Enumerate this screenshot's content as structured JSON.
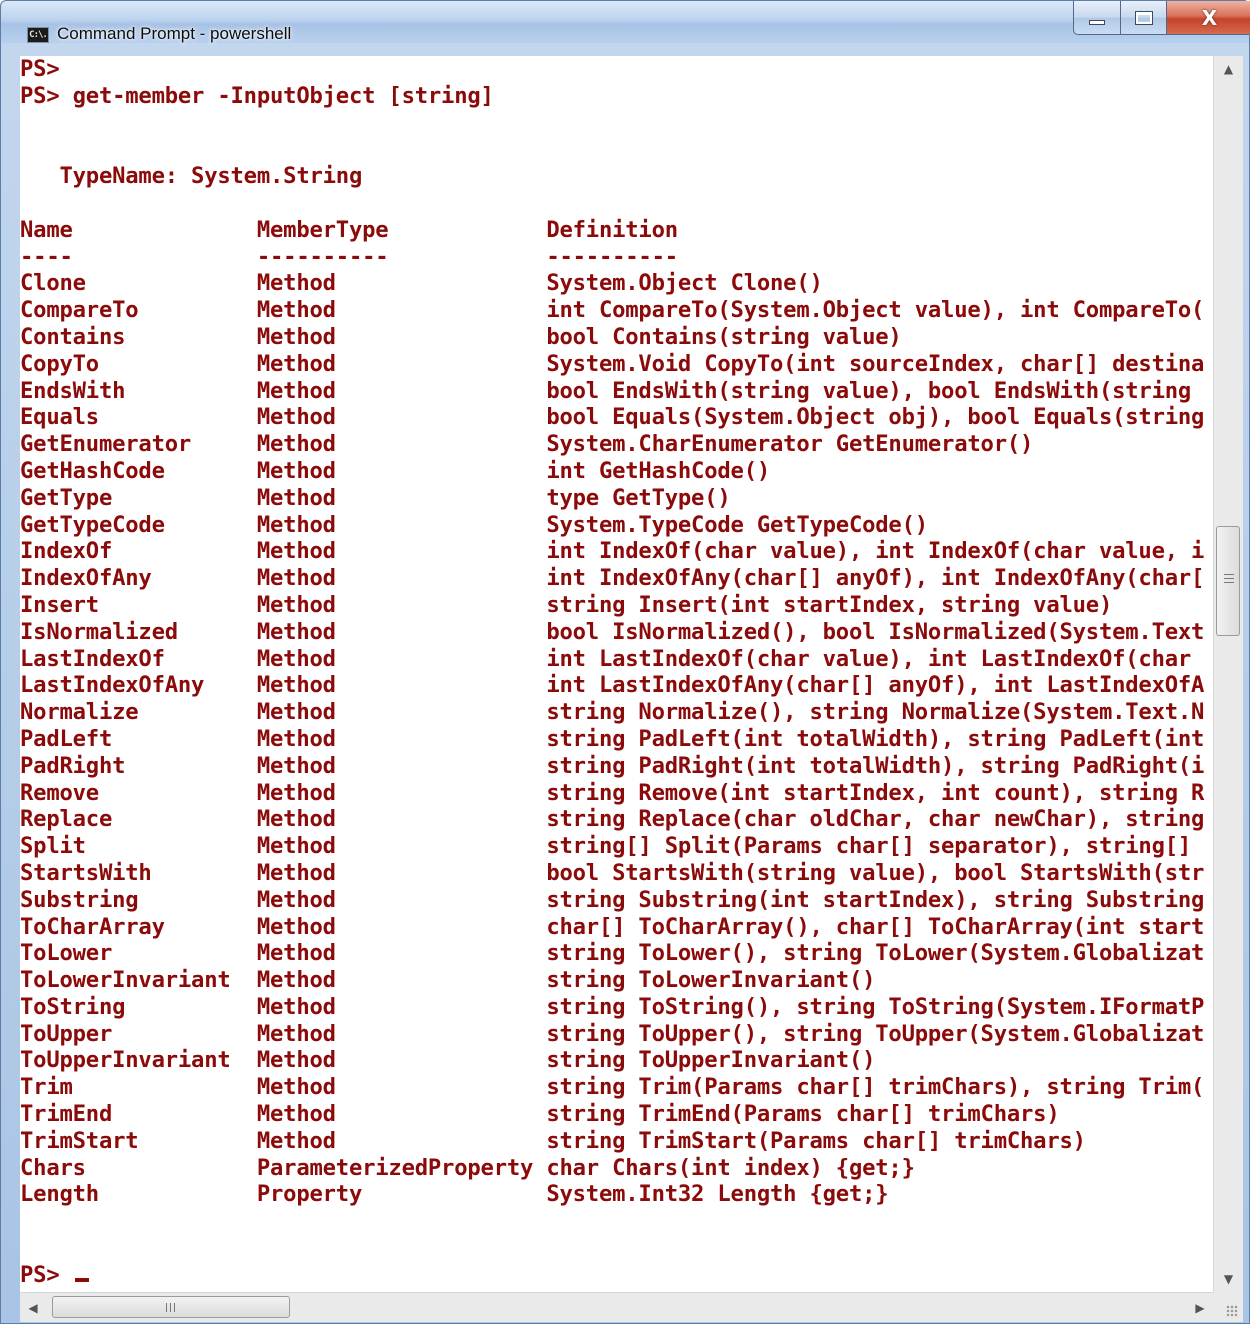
{
  "window": {
    "title": "Command Prompt - powershell",
    "icon": "console-icon",
    "icon_text": "C:\\.",
    "controls": {
      "minimize": "minimize-icon",
      "maximize": "maximize-icon",
      "close": "close-icon",
      "close_glyph": "X"
    }
  },
  "console": {
    "lines": [
      "PS>",
      "PS> get-member -InputObject [string]",
      "",
      "",
      "   TypeName: System.String",
      "",
      "Name              MemberType            Definition",
      "----              ----------            ----------",
      "Clone             Method                System.Object Clone()",
      "CompareTo         Method                int CompareTo(System.Object value), int CompareTo(",
      "Contains          Method                bool Contains(string value)",
      "CopyTo            Method                System.Void CopyTo(int sourceIndex, char[] destina",
      "EndsWith          Method                bool EndsWith(string value), bool EndsWith(string",
      "Equals            Method                bool Equals(System.Object obj), bool Equals(string",
      "GetEnumerator     Method                System.CharEnumerator GetEnumerator()",
      "GetHashCode       Method                int GetHashCode()",
      "GetType           Method                type GetType()",
      "GetTypeCode       Method                System.TypeCode GetTypeCode()",
      "IndexOf           Method                int IndexOf(char value), int IndexOf(char value, i",
      "IndexOfAny        Method                int IndexOfAny(char[] anyOf), int IndexOfAny(char[",
      "Insert            Method                string Insert(int startIndex, string value)",
      "IsNormalized      Method                bool IsNormalized(), bool IsNormalized(System.Text",
      "LastIndexOf       Method                int LastIndexOf(char value), int LastIndexOf(char",
      "LastIndexOfAny    Method                int LastIndexOfAny(char[] anyOf), int LastIndexOfA",
      "Normalize         Method                string Normalize(), string Normalize(System.Text.N",
      "PadLeft           Method                string PadLeft(int totalWidth), string PadLeft(int",
      "PadRight          Method                string PadRight(int totalWidth), string PadRight(i",
      "Remove            Method                string Remove(int startIndex, int count), string R",
      "Replace           Method                string Replace(char oldChar, char newChar), string",
      "Split             Method                string[] Split(Params char[] separator), string[]",
      "StartsWith        Method                bool StartsWith(string value), bool StartsWith(str",
      "Substring         Method                string Substring(int startIndex), string Substring",
      "ToCharArray       Method                char[] ToCharArray(), char[] ToCharArray(int start",
      "ToLower           Method                string ToLower(), string ToLower(System.Globalizat",
      "ToLowerInvariant  Method                string ToLowerInvariant()",
      "ToString          Method                string ToString(), string ToString(System.IFormatP",
      "ToUpper           Method                string ToUpper(), string ToUpper(System.Globalizat",
      "ToUpperInvariant  Method                string ToUpperInvariant()",
      "Trim              Method                string Trim(Params char[] trimChars), string Trim(",
      "TrimEnd           Method                string TrimEnd(Params char[] trimChars)",
      "TrimStart         Method                string TrimStart(Params char[] trimChars)",
      "Chars             ParameterizedProperty char Chars(int index) {get;}",
      "Length            Property              System.Int32 Length {get;}",
      "",
      "",
      "PS> "
    ],
    "colors": {
      "text": "#8b0a0a",
      "background": "#ffffff"
    }
  },
  "scrollbars": {
    "vertical": {
      "up": "arrow-up-icon",
      "down": "arrow-down-icon"
    },
    "horizontal": {
      "left": "arrow-left-icon",
      "right": "arrow-right-icon"
    }
  }
}
